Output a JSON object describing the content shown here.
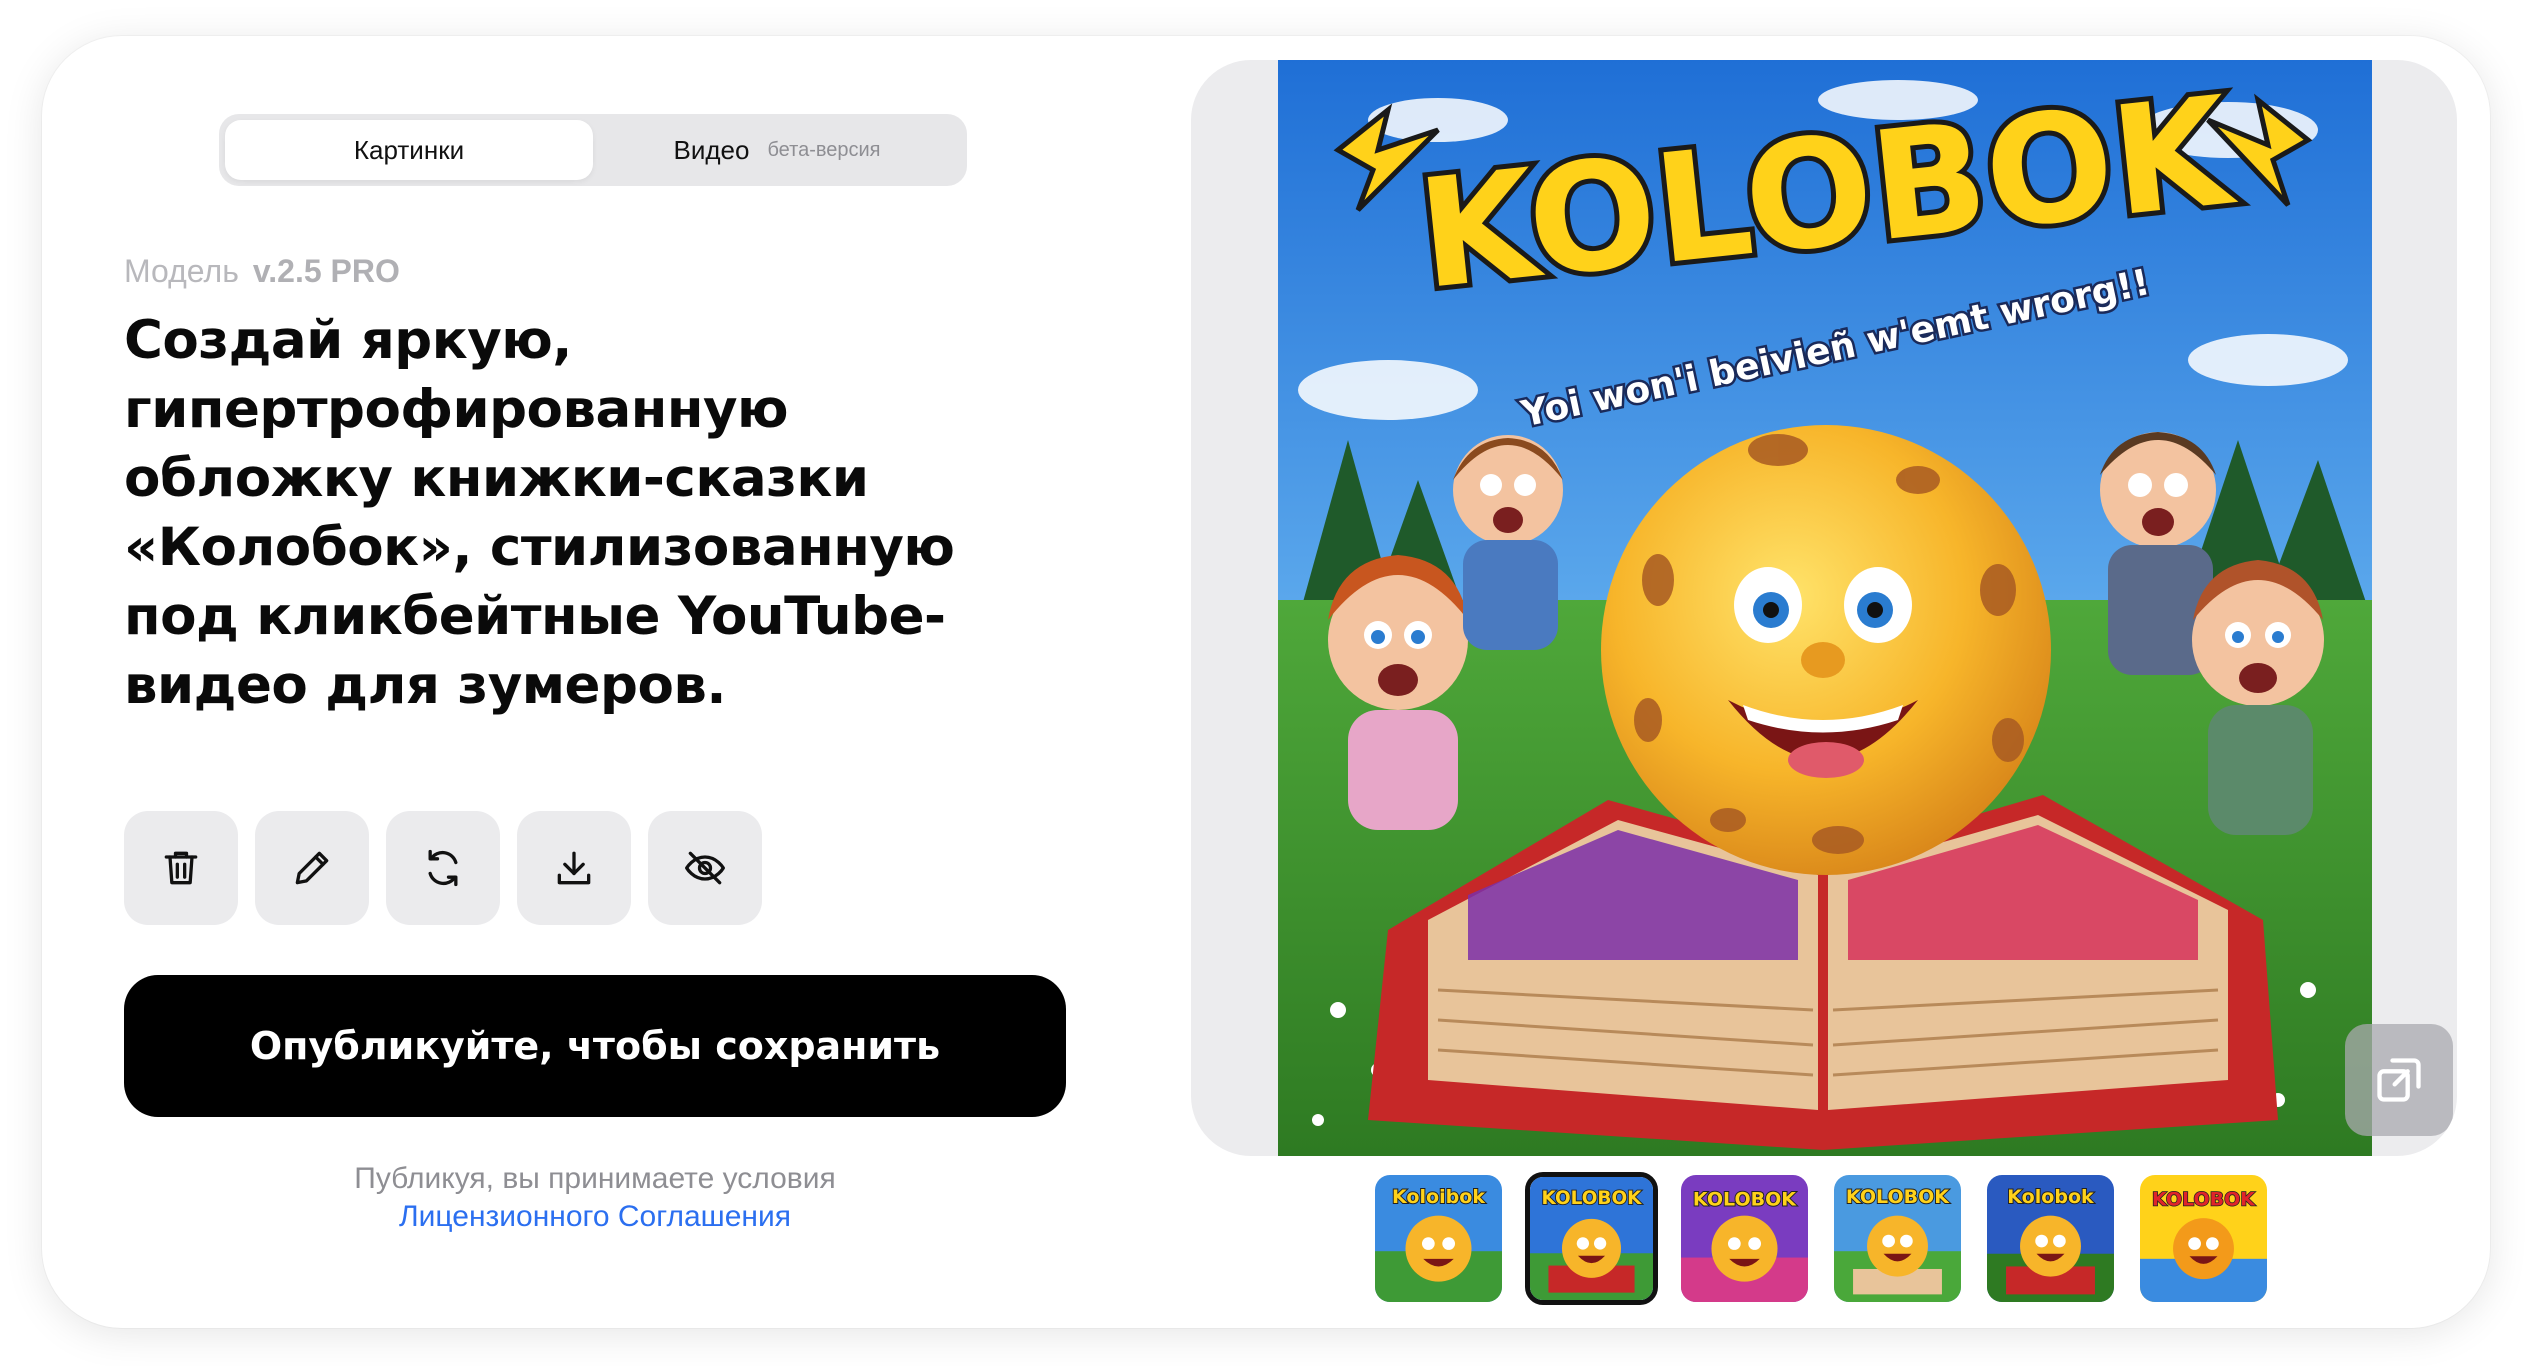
{
  "tabs": {
    "images_label": "Картинки",
    "video_label": "Видео",
    "video_badge": "бета-версия"
  },
  "model": {
    "label": "Модель",
    "version": "v.2.5 PRO"
  },
  "prompt": {
    "text": "Создай яркую, гипертрофированную обложку книжки-сказки «Колобок», стилизованную под кликбейтные YouTube-видео для зумеров."
  },
  "actions": {
    "delete_icon": "trash-icon",
    "edit_icon": "pencil-icon",
    "regenerate_icon": "refresh-icon",
    "download_icon": "download-icon",
    "hide_icon": "eye-off-icon"
  },
  "publish": {
    "label": "Опубликуйте, чтобы сохранить"
  },
  "terms": {
    "text": "Публикуя, вы принимаете условия",
    "link": "Лицензионного Соглашения",
    "link_color": "#2b6ff0"
  },
  "preview": {
    "title": "KOLOBOK",
    "subtitle": "Yoi won'i beivieñ w'emt wrorg!!",
    "expand_icon": "expand-icon"
  },
  "thumbnails": [
    {
      "label": "Koloibok",
      "selected": false
    },
    {
      "label": "KOLOBOK",
      "selected": true
    },
    {
      "label": "KOLOBOK",
      "selected": false
    },
    {
      "label": "KOLOBOK",
      "selected": false
    },
    {
      "label": "Kolobok",
      "selected": false
    },
    {
      "label": "KOLOBOK",
      "selected": false
    }
  ],
  "colors": {
    "accent_black": "#000000",
    "link_blue": "#2b6ff0",
    "muted": "#8e8e93",
    "panel_bg": "#ececee"
  }
}
